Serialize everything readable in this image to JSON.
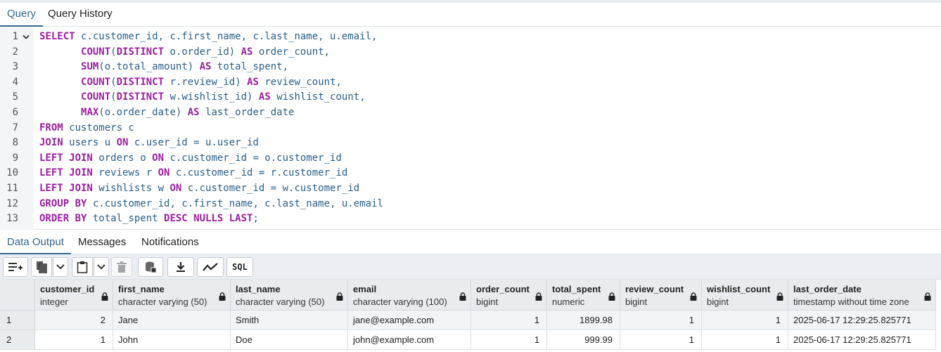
{
  "query_tabs": [
    "Query",
    "Query History"
  ],
  "editor": {
    "lines": [
      {
        "n": "1",
        "fold": true,
        "tokens": [
          [
            "k",
            "SELECT"
          ],
          [
            "t",
            " c.customer_id, c.first_name, c.last_name, u.email,"
          ]
        ]
      },
      {
        "n": "2",
        "tokens": [
          [
            "t",
            "       "
          ],
          [
            "k",
            "COUNT"
          ],
          [
            "t",
            "("
          ],
          [
            "k",
            "DISTINCT"
          ],
          [
            "t",
            " o.order_id) "
          ],
          [
            "k",
            "AS"
          ],
          [
            "t",
            " order_count,"
          ]
        ]
      },
      {
        "n": "3",
        "tokens": [
          [
            "t",
            "       "
          ],
          [
            "k",
            "SUM"
          ],
          [
            "t",
            "(o.total_amount) "
          ],
          [
            "k",
            "AS"
          ],
          [
            "t",
            " total_spent,"
          ]
        ]
      },
      {
        "n": "4",
        "tokens": [
          [
            "t",
            "       "
          ],
          [
            "k",
            "COUNT"
          ],
          [
            "t",
            "("
          ],
          [
            "k",
            "DISTINCT"
          ],
          [
            "t",
            " r.review_id) "
          ],
          [
            "k",
            "AS"
          ],
          [
            "t",
            " review_count,"
          ]
        ]
      },
      {
        "n": "5",
        "tokens": [
          [
            "t",
            "       "
          ],
          [
            "k",
            "COUNT"
          ],
          [
            "t",
            "("
          ],
          [
            "k",
            "DISTINCT"
          ],
          [
            "t",
            " w.wishlist_id) "
          ],
          [
            "k",
            "AS"
          ],
          [
            "t",
            " wishlist_count,"
          ]
        ]
      },
      {
        "n": "6",
        "tokens": [
          [
            "t",
            "       "
          ],
          [
            "k",
            "MAX"
          ],
          [
            "t",
            "(o.order_date) "
          ],
          [
            "k",
            "AS"
          ],
          [
            "t",
            " last_order_date"
          ]
        ]
      },
      {
        "n": "7",
        "tokens": [
          [
            "k",
            "FROM"
          ],
          [
            "t",
            " customers c"
          ]
        ]
      },
      {
        "n": "8",
        "tokens": [
          [
            "k",
            "JOIN"
          ],
          [
            "t",
            " users u "
          ],
          [
            "k",
            "ON"
          ],
          [
            "t",
            " c.user_id = u.user_id"
          ]
        ]
      },
      {
        "n": "9",
        "tokens": [
          [
            "k",
            "LEFT JOIN"
          ],
          [
            "t",
            " orders o "
          ],
          [
            "k",
            "ON"
          ],
          [
            "t",
            " c.customer_id = o.customer_id"
          ]
        ]
      },
      {
        "n": "10",
        "tokens": [
          [
            "k",
            "LEFT JOIN"
          ],
          [
            "t",
            " reviews r "
          ],
          [
            "k",
            "ON"
          ],
          [
            "t",
            " c.customer_id = r.customer_id"
          ]
        ]
      },
      {
        "n": "11",
        "tokens": [
          [
            "k",
            "LEFT JOIN"
          ],
          [
            "t",
            " wishlists w "
          ],
          [
            "k",
            "ON"
          ],
          [
            "t",
            " c.customer_id = w.customer_id"
          ]
        ]
      },
      {
        "n": "12",
        "tokens": [
          [
            "k",
            "GROUP BY"
          ],
          [
            "t",
            " c.customer_id, c.first_name, c.last_name, u.email"
          ]
        ]
      },
      {
        "n": "13",
        "tokens": [
          [
            "k",
            "ORDER BY"
          ],
          [
            "t",
            " total_spent "
          ],
          [
            "k",
            "DESC NULLS LAST"
          ],
          [
            "t",
            ";"
          ]
        ]
      }
    ]
  },
  "output_tabs": [
    "Data Output",
    "Messages",
    "Notifications"
  ],
  "toolbar": {
    "icons": [
      "add-row-icon",
      "copy-icon",
      "chevron-down-icon",
      "paste-icon",
      "chevron-down-icon",
      "delete-icon",
      "save-data-icon",
      "download-icon",
      "graph-icon",
      "sql-icon"
    ],
    "sql_label": "SQL"
  },
  "grid": {
    "columns": [
      {
        "name": "customer_id",
        "type": "integer"
      },
      {
        "name": "first_name",
        "type": "character varying (50)"
      },
      {
        "name": "last_name",
        "type": "character varying (50)"
      },
      {
        "name": "email",
        "type": "character varying (100)"
      },
      {
        "name": "order_count",
        "type": "bigint"
      },
      {
        "name": "total_spent",
        "type": "numeric"
      },
      {
        "name": "review_count",
        "type": "bigint"
      },
      {
        "name": "wishlist_count",
        "type": "bigint"
      },
      {
        "name": "last_order_date",
        "type": "timestamp without time zone"
      }
    ],
    "rows": [
      {
        "n": "1",
        "cells": [
          "2",
          "Jane",
          "Smith",
          "jane@example.com",
          "1",
          "1899.98",
          "1",
          "1",
          "2025-06-17 12:29:25.825771"
        ]
      },
      {
        "n": "2",
        "cells": [
          "1",
          "John",
          "Doe",
          "john@example.com",
          "1",
          "999.99",
          "1",
          "1",
          "2025-06-17 12:29:25.825771"
        ]
      }
    ]
  }
}
